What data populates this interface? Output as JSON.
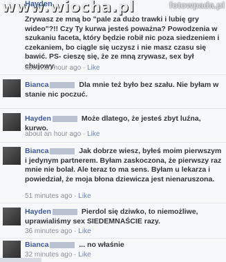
{
  "watermark": {
    "left": "www.wiocha.pl",
    "right": "fotowpada.pl"
  },
  "comments": [
    {
      "author": "Hayden",
      "text": "Zrywasz ze mną bo \"pale za dużo trawki i lubię gry wideo\"?!! Czy Ty kurwa jesteś poważna? Powodzenia w szukaniu faceta, który będzie robił nic poza siedzeniem i czekaniem, bo ciągle się uczysz i nie masz czasu się bawić. PS- cieszę się, że ze mną zrywasz, sex był chujowy.",
      "time": "about an hour ago",
      "like": "Like"
    },
    {
      "author": "Bianca",
      "text": "Dla mnie też było bez szału. Nie byłam w stanie nic poczuć.",
      "time": "about an hour ago",
      "like": "Like"
    },
    {
      "author": "Hayden",
      "text": "Może dlatego, że jesteś zbyt luźna, kurwo.",
      "time": "about an hour ago",
      "like": "Like"
    },
    {
      "author": "Bianca",
      "text": "Jak dobrze wiesz, byłeś moim pierwszym i jedynym partnerem. Byłam zaskoczona, że pierwszy raz mnie nie bolał. Ale teraz to ma sens. Byłam u lekarza i powiedział, że moja błona dziewicza jest nienaruszona.",
      "time": "51 minutes ago",
      "like": "Like"
    },
    {
      "author": "Hayden",
      "text": "Pierdol się dziwko, to niemożliwe, uprawialiśmy sex SIEDEMNAŚCIE razy.",
      "time": "36 minutes ago",
      "like": "Like"
    },
    {
      "author": "Bianca",
      "text": "... no właśnie",
      "time": "32 minutes ago",
      "like": "Like"
    }
  ]
}
